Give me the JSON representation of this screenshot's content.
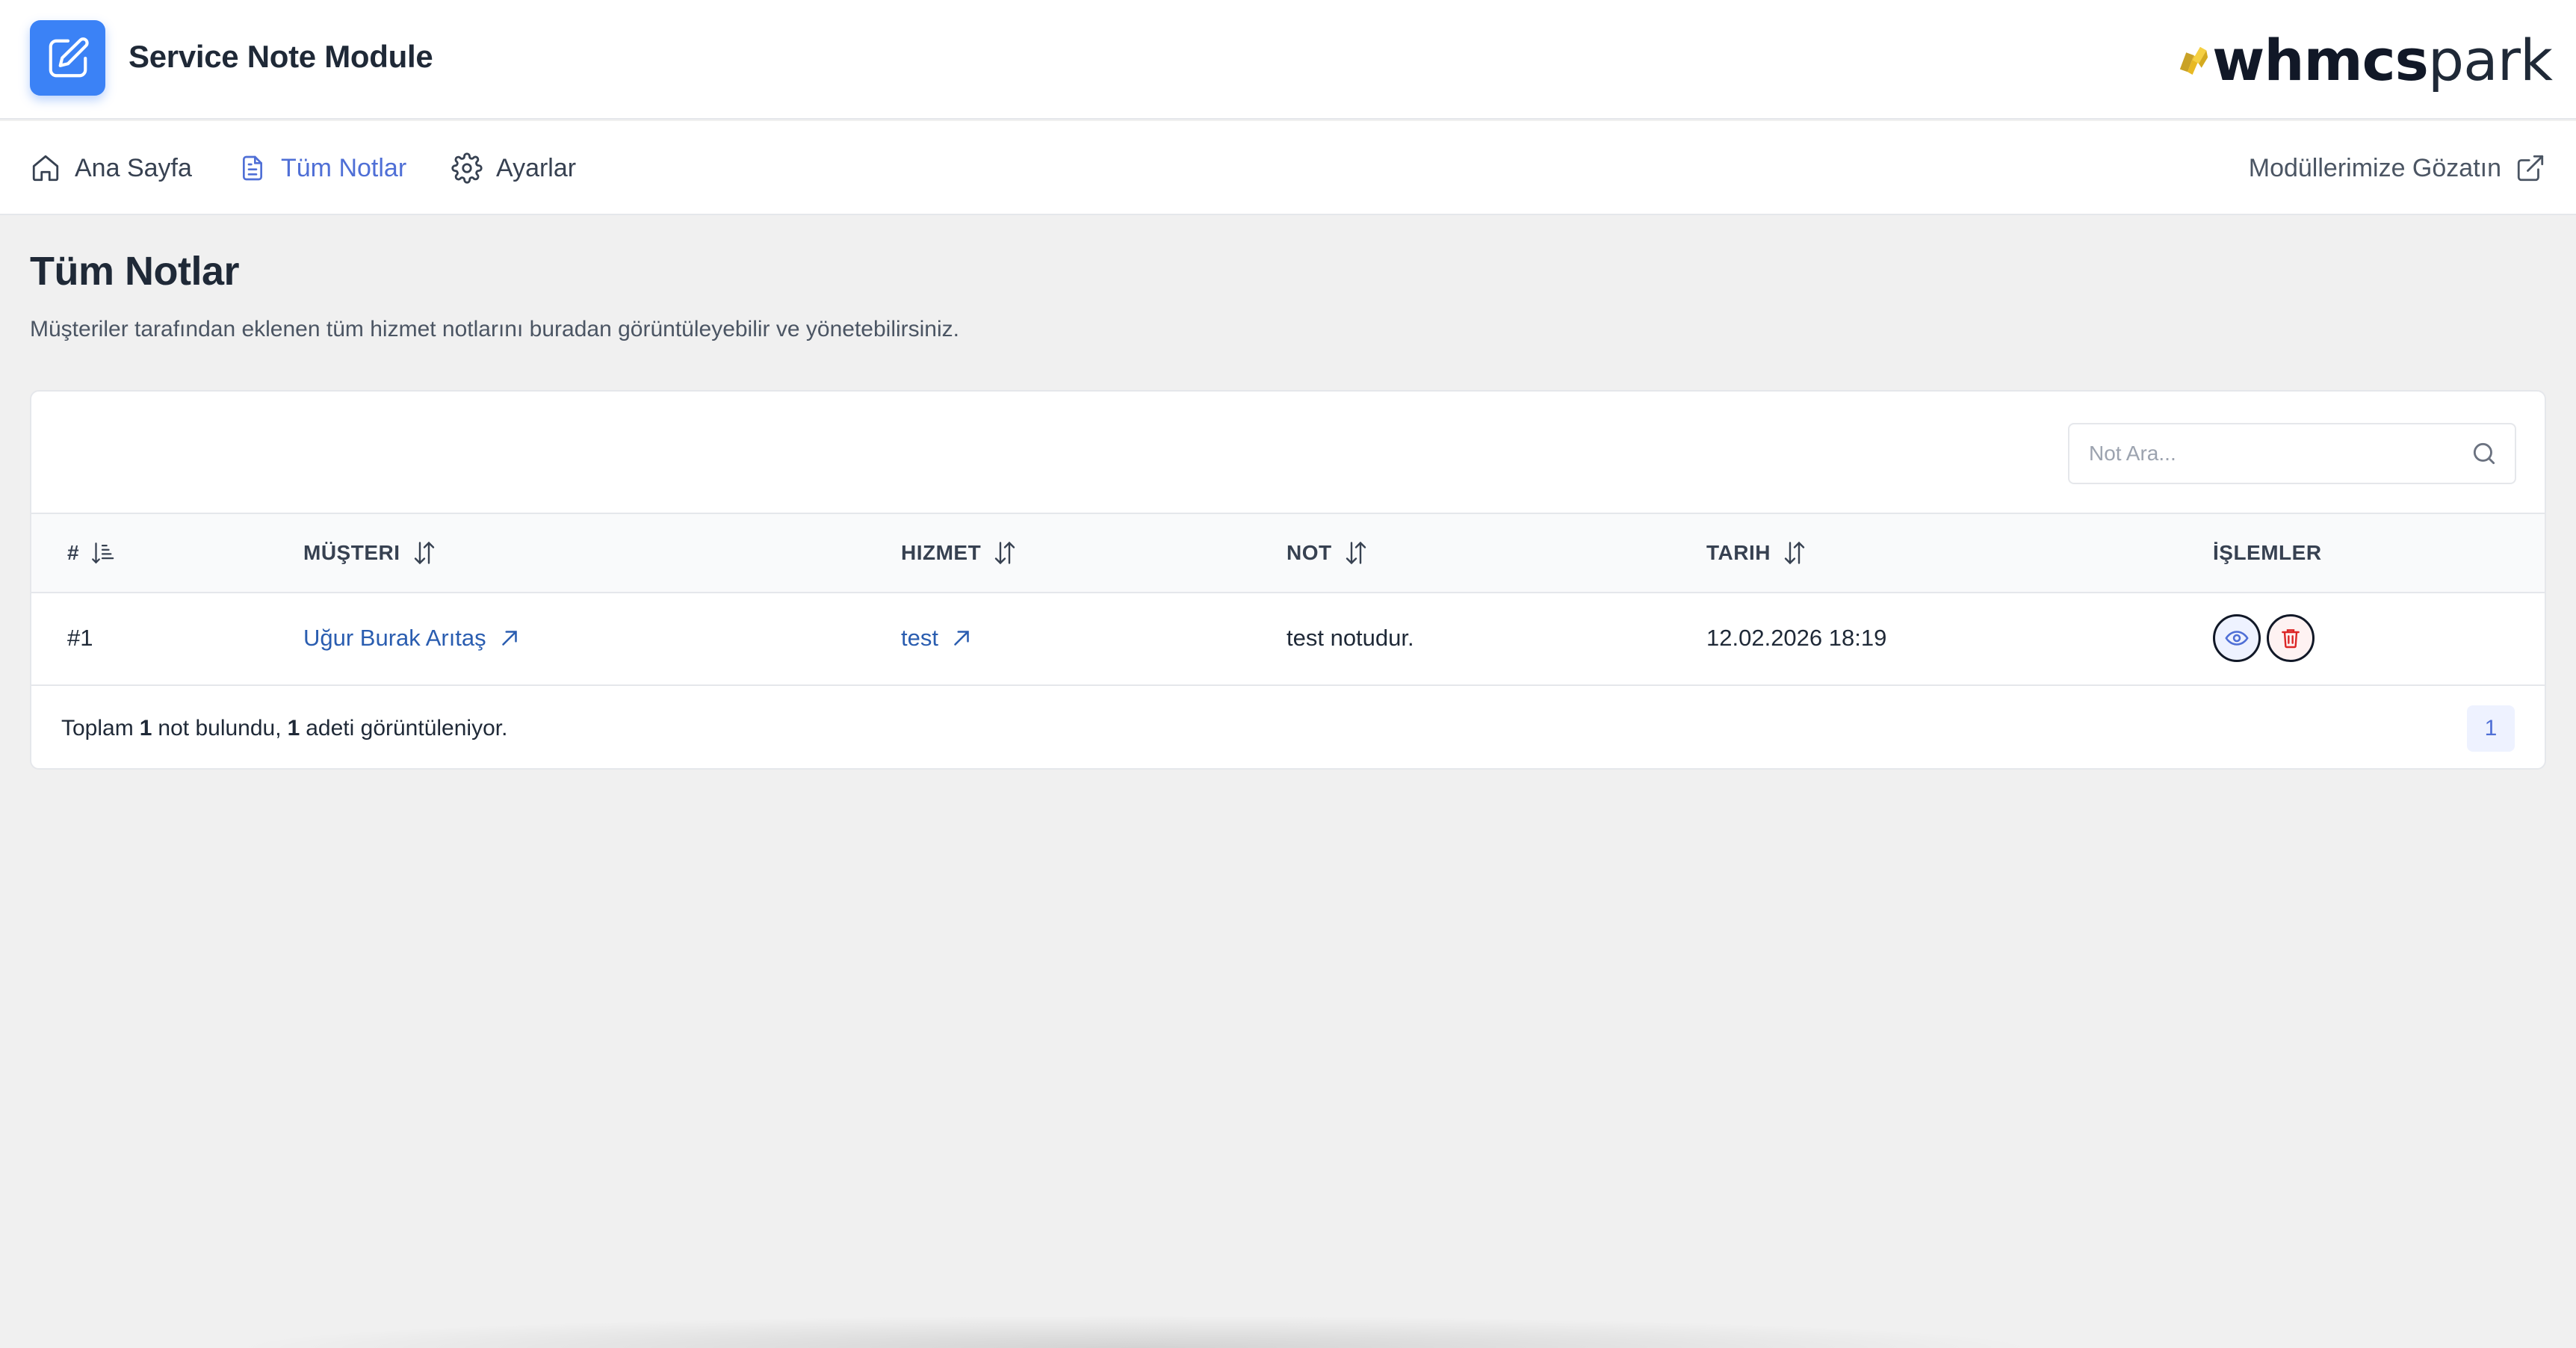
{
  "app": {
    "title": "Service Note Module",
    "logo_icon": "edit-note-icon",
    "brand_bold": "whmcs",
    "brand_light": "park",
    "brand_color": "#e8b923"
  },
  "nav": {
    "items": [
      {
        "label": "Ana Sayfa",
        "icon": "home-icon",
        "active": false
      },
      {
        "label": "Tüm Notlar",
        "icon": "document-icon",
        "active": true
      },
      {
        "label": "Ayarlar",
        "icon": "gear-icon",
        "active": false
      }
    ],
    "external_link": {
      "label": "Modüllerimize Gözatın",
      "icon": "external-link-icon"
    }
  },
  "page": {
    "title": "Tüm Notlar",
    "description": "Müşteriler tarafından eklenen tüm hizmet notlarını buradan görüntüleyebilir ve yönetebilirsiniz."
  },
  "search": {
    "placeholder": "Not Ara...",
    "value": ""
  },
  "table": {
    "columns": [
      {
        "label": "#",
        "sort": "sorted-asc"
      },
      {
        "label": "MÜŞTERI",
        "sort": "sortable"
      },
      {
        "label": "HIZMET",
        "sort": "sortable"
      },
      {
        "label": "NOT",
        "sort": "sortable"
      },
      {
        "label": "TARIH",
        "sort": "sortable"
      },
      {
        "label": "İŞLEMLER",
        "sort": "none"
      }
    ],
    "rows": [
      {
        "id": "#1",
        "customer": "Uğur Burak Arıtaş",
        "service": "test",
        "note": "test notudur.",
        "date": "12.02.2026 18:19",
        "actions": [
          "view-icon",
          "delete-icon"
        ]
      }
    ]
  },
  "footer": {
    "prefix": "Toplam",
    "total": "1",
    "middle": "not bulundu,",
    "shown": "1",
    "suffix": "adeti görüntüleniyor.",
    "current_page": "1"
  },
  "colors": {
    "accent": "#4f6fd6",
    "link": "#2a5db0",
    "danger": "#dc2626",
    "logo_bg": "#3b82f6"
  }
}
